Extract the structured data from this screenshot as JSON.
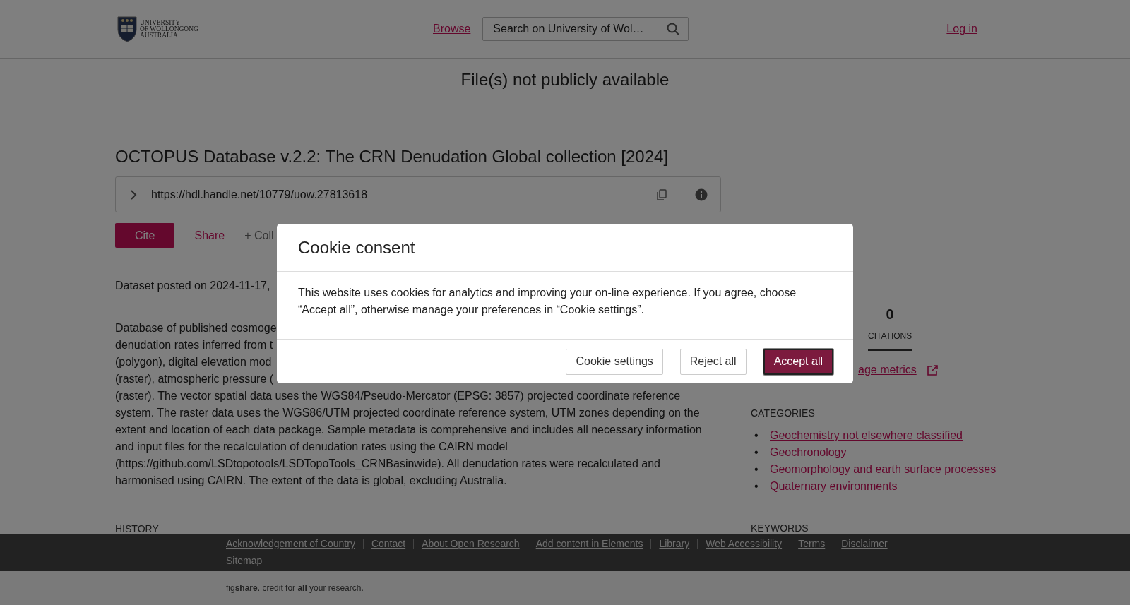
{
  "header": {
    "logo_lines": [
      "UNIVERSITY",
      "OF WOLLONGONG",
      "AUSTRALIA"
    ],
    "browse": "Browse",
    "search": {
      "placeholder": "Search on University of Wol…"
    },
    "login": "Log in"
  },
  "banner": "File(s) not publicly available",
  "article": {
    "title": "OCTOPUS Database v.2.2: The CRN Denudation Global collection [2024]",
    "handle": {
      "url": "https://hdl.handle.net/10779/uow.27813618"
    },
    "actions": [
      {
        "label": "Cite",
        "kind": "primary"
      },
      {
        "label": "Share",
        "kind": "link"
      },
      {
        "label": "+ Coll",
        "kind": "muted"
      }
    ],
    "posted": {
      "type": "Dataset",
      "text": "posted on 2024-11-17,"
    },
    "description_lines": [
      "Database of published cosmoge",
      "denudation rates inferred from t",
      "(polygon), digital elevation mod",
      "(raster), atmospheric pressure (",
      "(raster). The vector spatial data uses the WGS84/Pseudo-Mercator (EPSG: 3857) projected coordinate reference",
      "system. The raster data uses the WGS86/UTM projected coordinate reference system, UTM zones depending on the",
      "extent and location of each data package. Sample metadata is comprehensive and includes all necessary information",
      "and input files for the recalculation of denudation rates using the CAIRN model",
      "(https://github.com/LSDtopotools/LSDTopoTools_CRNBasinwide). All denudation rates were recalculated and",
      "harmonised using CAIRN. The extent of the data is global, excluding Australia."
    ],
    "history_heading": "HISTORY"
  },
  "sidebar": {
    "metrics": [
      {
        "value": "0",
        "label": "CITATIONS",
        "selected": true
      }
    ],
    "usage_link": "age metrics",
    "categories_heading": "CATEGORIES",
    "categories": [
      {
        "marker": "•",
        "label": "Geochemistry not elsewhere classified"
      },
      {
        "marker": "•",
        "label": "Geochronology"
      },
      {
        "marker": "•",
        "label": "Geomorphology and earth surface processes"
      },
      {
        "marker": "•",
        "label": "Quaternary environments"
      }
    ],
    "keywords_heading": "KEYWORDS"
  },
  "footer": {
    "links": [
      "Acknowledgement of Country",
      "Contact",
      "About Open Research",
      "Add content in Elements",
      "Library",
      "Web Accessibility",
      "Terms",
      "Disclaimer",
      "Sitemap"
    ],
    "credit": "fig**share**. credit for **all** your research."
  },
  "cookie_dialog": {
    "title": "Cookie consent",
    "message": "This website uses cookies for analytics and improving your on-line experience. If you agree, choose “Accept all”, otherwise manage your preferences in “Cookie settings”.",
    "buttons": [
      {
        "label": "Cookie settings",
        "kind": "secondary"
      },
      {
        "label": "Reject all",
        "kind": "secondary"
      },
      {
        "label": "Accept all",
        "kind": "primary"
      }
    ]
  }
}
